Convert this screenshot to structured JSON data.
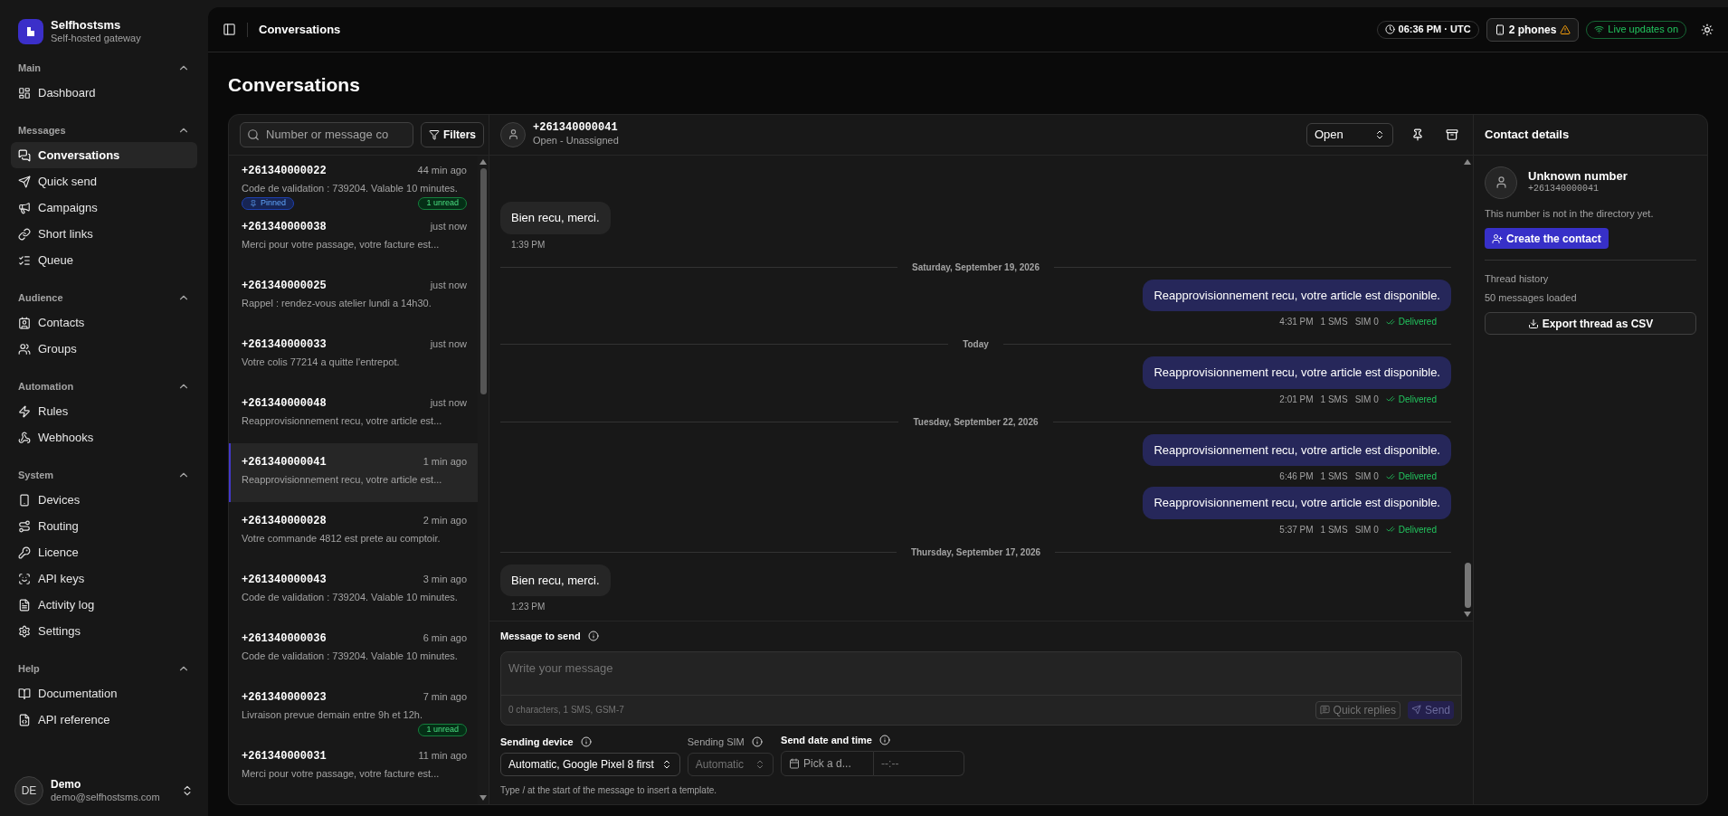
{
  "brand": {
    "name": "Selfhostsms",
    "tagline": "Self-hosted gateway"
  },
  "sidebar": {
    "sections": [
      {
        "title": "Main",
        "items": [
          {
            "label": "Dashboard",
            "selected": false
          }
        ]
      },
      {
        "title": "Messages",
        "items": [
          {
            "label": "Conversations",
            "selected": true
          },
          {
            "label": "Quick send",
            "selected": false
          },
          {
            "label": "Campaigns",
            "selected": false
          },
          {
            "label": "Short links",
            "selected": false
          },
          {
            "label": "Queue",
            "selected": false
          }
        ]
      },
      {
        "title": "Audience",
        "items": [
          {
            "label": "Contacts",
            "selected": false
          },
          {
            "label": "Groups",
            "selected": false
          }
        ]
      },
      {
        "title": "Automation",
        "items": [
          {
            "label": "Rules",
            "selected": false
          },
          {
            "label": "Webhooks",
            "selected": false
          }
        ]
      },
      {
        "title": "System",
        "items": [
          {
            "label": "Devices",
            "selected": false
          },
          {
            "label": "Routing",
            "selected": false
          },
          {
            "label": "Licence",
            "selected": false
          },
          {
            "label": "API keys",
            "selected": false
          },
          {
            "label": "Activity log",
            "selected": false
          },
          {
            "label": "Settings",
            "selected": false
          }
        ]
      },
      {
        "title": "Help",
        "items": [
          {
            "label": "Documentation",
            "selected": false
          },
          {
            "label": "API reference",
            "selected": false
          }
        ]
      }
    ],
    "user": {
      "initials": "DE",
      "name": "Demo",
      "email": "demo@selfhostsms.com"
    }
  },
  "topbar": {
    "title": "Conversations",
    "time": "06:36 PM · UTC",
    "phones": "2 phones",
    "live": "Live updates on"
  },
  "page_title": "Conversations",
  "list": {
    "search_placeholder": "Number or message co",
    "filters": "Filters",
    "conversations": [
      {
        "number": "+261340000022",
        "time": "44 min ago",
        "preview": "Code de validation : 739204. Valable 10 minutes.",
        "pinned": "Pinned",
        "unread": "1 unread",
        "selected": false
      },
      {
        "number": "+261340000038",
        "time": "just now",
        "preview": "Merci pour votre passage, votre facture est...",
        "selected": false
      },
      {
        "number": "+261340000025",
        "time": "just now",
        "preview": "Rappel : rendez-vous atelier lundi a 14h30.",
        "selected": false
      },
      {
        "number": "+261340000033",
        "time": "just now",
        "preview": "Votre colis 77214 a quitte l'entrepot.",
        "selected": false
      },
      {
        "number": "+261340000048",
        "time": "just now",
        "preview": "Reapprovisionnement recu, votre article est...",
        "selected": false
      },
      {
        "number": "+261340000041",
        "time": "1 min ago",
        "preview": "Reapprovisionnement recu, votre article est...",
        "selected": true
      },
      {
        "number": "+261340000028",
        "time": "2 min ago",
        "preview": "Votre commande 4812 est prete au comptoir.",
        "selected": false
      },
      {
        "number": "+261340000043",
        "time": "3 min ago",
        "preview": "Code de validation : 739204. Valable 10 minutes.",
        "selected": false
      },
      {
        "number": "+261340000036",
        "time": "6 min ago",
        "preview": "Code de validation : 739204. Valable 10 minutes.",
        "selected": false
      },
      {
        "number": "+261340000023",
        "time": "7 min ago",
        "preview": "Livraison prevue demain entre 9h et 12h.",
        "unread": "1 unread",
        "selected": false
      },
      {
        "number": "+261340000031",
        "time": "11 min ago",
        "preview": "Merci pour votre passage, votre facture est...",
        "selected": false
      }
    ]
  },
  "chat": {
    "number": "+261340000041",
    "subtitle": "Open - Unassigned",
    "status": "Open",
    "messages": [
      {
        "kind": "incoming",
        "text": "Bien recu, merci.",
        "time": "1:39 PM"
      },
      {
        "kind": "date",
        "text": "Saturday, September 19, 2026"
      },
      {
        "kind": "outgoing",
        "text": "Reapprovisionnement recu, votre article est disponible.",
        "time": "4:31 PM",
        "parts": "1 SMS",
        "sim": "SIM 0",
        "status": "Delivered"
      },
      {
        "kind": "date",
        "text": "Today"
      },
      {
        "kind": "outgoing",
        "text": "Reapprovisionnement recu, votre article est disponible.",
        "time": "2:01 PM",
        "parts": "1 SMS",
        "sim": "SIM 0",
        "status": "Delivered"
      },
      {
        "kind": "date",
        "text": "Tuesday, September 22, 2026"
      },
      {
        "kind": "outgoing",
        "text": "Reapprovisionnement recu, votre article est disponible.",
        "time": "6:46 PM",
        "parts": "1 SMS",
        "sim": "SIM 0",
        "status": "Delivered"
      },
      {
        "kind": "outgoing",
        "text": "Reapprovisionnement recu, votre article est disponible.",
        "time": "5:37 PM",
        "parts": "1 SMS",
        "sim": "SIM 0",
        "status": "Delivered"
      },
      {
        "kind": "date",
        "text": "Thursday, September 17, 2026"
      },
      {
        "kind": "incoming",
        "text": "Bien recu, merci.",
        "time": "1:23 PM"
      }
    ]
  },
  "composer": {
    "label": "Message to send",
    "placeholder": "Write your message",
    "counter": "0 characters, 1 SMS, GSM-7",
    "quick_replies": "Quick replies",
    "send": "Send",
    "device_label": "Sending device",
    "device": "Automatic, Google Pixel 8 first",
    "sim_label": "Sending SIM",
    "sim": "Automatic",
    "sim_disabled": true,
    "date_label": "Send date and time",
    "date_placeholder": "Pick a d...",
    "time_placeholder": "--:--",
    "hint": "Type / at the start of the message to insert a template."
  },
  "contact": {
    "title": "Contact details",
    "name": "Unknown number",
    "number": "+261340000041",
    "note": "This number is not in the directory yet.",
    "create": "Create the contact",
    "history_title": "Thread history",
    "history_count": "50 messages loaded",
    "export": "Export thread as CSV"
  }
}
